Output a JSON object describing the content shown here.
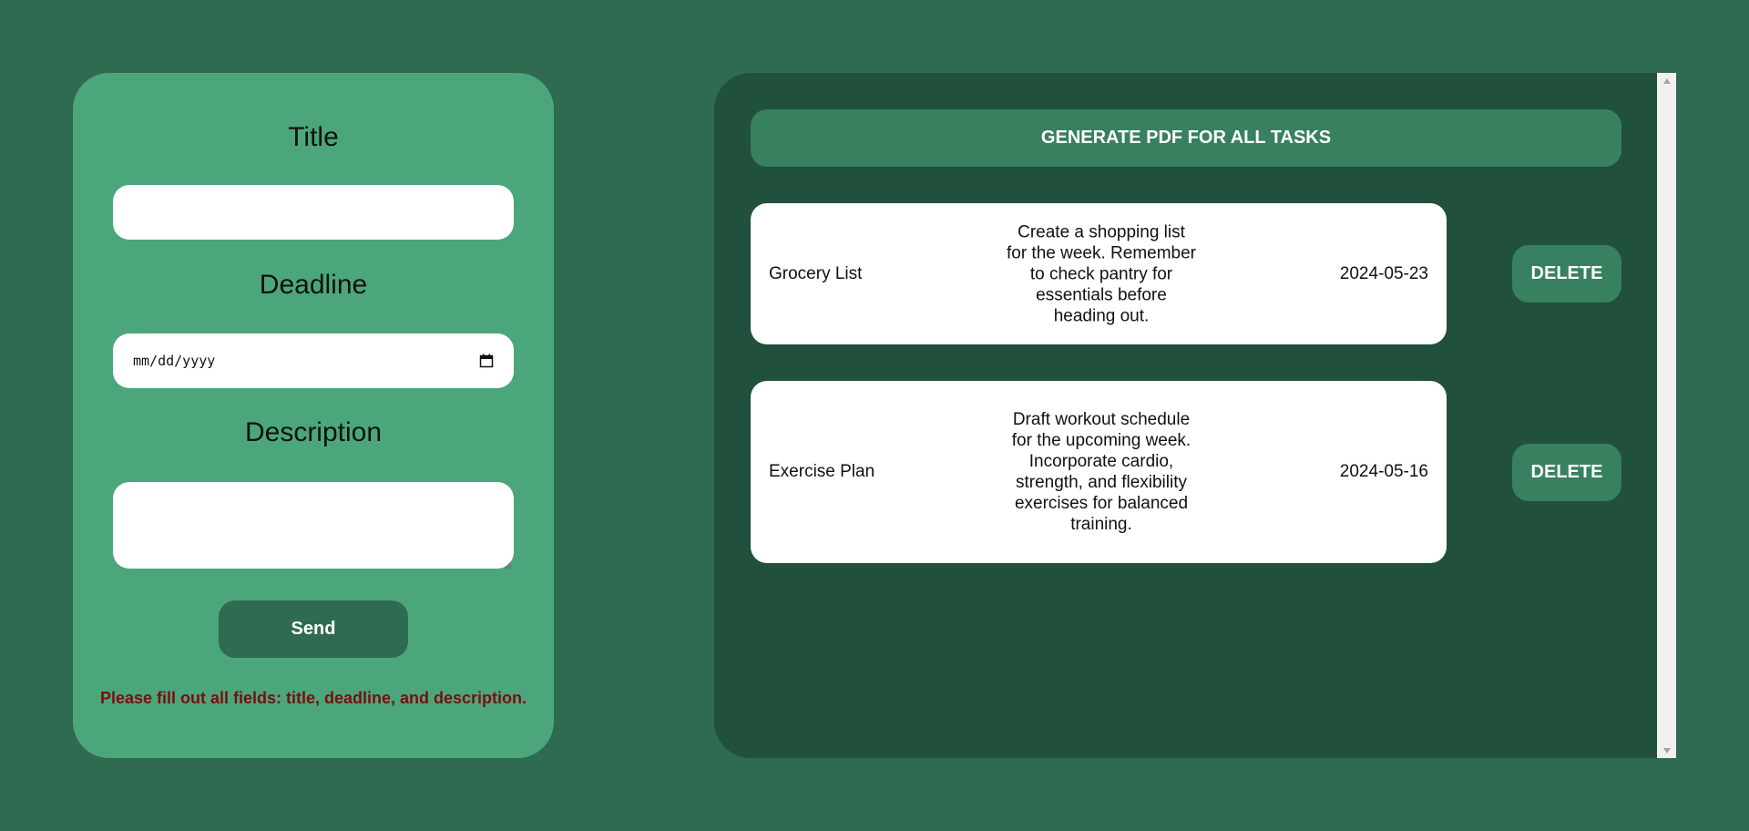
{
  "form": {
    "title_label": "Title",
    "title_value": "",
    "deadline_label": "Deadline",
    "deadline_placeholder": "mm/dd/yyyy",
    "description_label": "Description",
    "description_value": "",
    "send_label": "Send",
    "error_message": "Please fill out all fields: title, deadline, and description."
  },
  "tasks_panel": {
    "pdf_button_label": "GENERATE PDF FOR ALL TASKS",
    "delete_label": "DELETE",
    "tasks": [
      {
        "title": "Grocery List",
        "description": "Create a shopping list for the week. Remember to check pantry for essentials before heading out.",
        "deadline": "2024-05-23"
      },
      {
        "title": "Exercise Plan",
        "description": "Draft workout schedule for the upcoming week. Incorporate cardio, strength, and flexibility exercises for balanced training.",
        "deadline": "2024-05-16"
      }
    ]
  },
  "icons": {
    "calendar": "calendar-icon",
    "resize": "resize-handle-icon",
    "scroll_up": "scroll-up-arrow-icon",
    "scroll_down": "scroll-down-arrow-icon"
  },
  "colors": {
    "page_background": "#2e6b50",
    "form_panel": "#4ca67c",
    "tasks_panel": "#21503d",
    "button": "#378060",
    "send_button": "#2f6b50",
    "error_text": "#7a0e0e"
  }
}
